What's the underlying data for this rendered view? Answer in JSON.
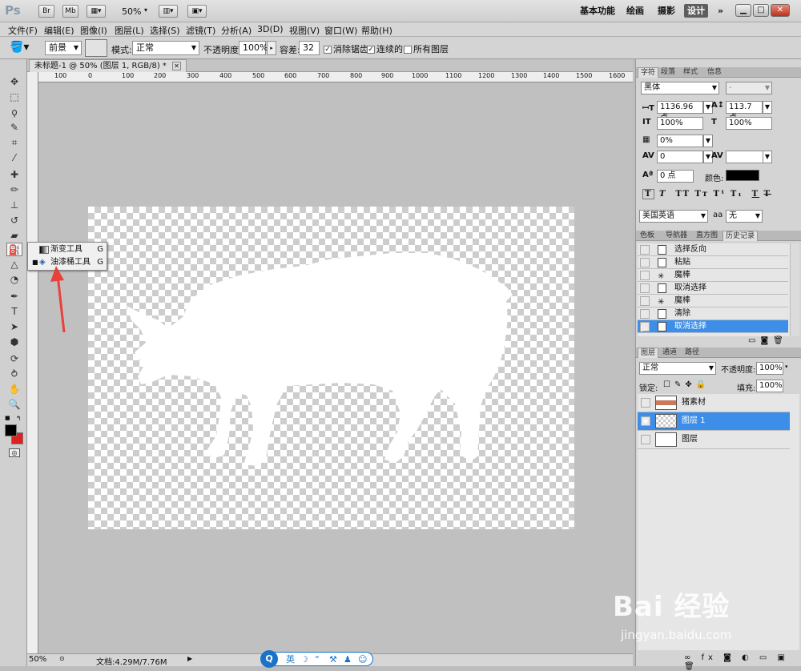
{
  "app": {
    "logo": "Ps",
    "chips": [
      "Br",
      "Mb"
    ],
    "zoom": "50%",
    "workspaces": [
      "基本功能",
      "绘画",
      "摄影",
      "设计"
    ],
    "active_workspace": "设计",
    "more": "»"
  },
  "menu": [
    "文件(F)",
    "编辑(E)",
    "图像(I)",
    "图层(L)",
    "选择(S)",
    "滤镜(T)",
    "分析(A)",
    "3D(D)",
    "视图(V)",
    "窗口(W)",
    "帮助(H)"
  ],
  "options": {
    "fill_source": "前景",
    "mode_label": "模式:",
    "mode": "正常",
    "opacity_label": "不透明度:",
    "opacity": "100%",
    "tolerance_label": "容差:",
    "tolerance": "32",
    "antialias": "消除锯齿",
    "contiguous": "连续的",
    "all_layers": "所有图层"
  },
  "document": {
    "tab": "未标题-1 @ 50% (图层 1, RGB/8) *",
    "ruler_h": [
      "100",
      "0",
      "100",
      "200",
      "300",
      "400",
      "500",
      "600",
      "700",
      "800",
      "900",
      "1000",
      "1100",
      "1200",
      "1300",
      "1400",
      "1500",
      "1600"
    ]
  },
  "flyout": {
    "items": [
      {
        "label": "渐变工具",
        "key": "G"
      },
      {
        "label": "油漆桶工具",
        "key": "G"
      }
    ]
  },
  "status": {
    "zoom": "50%",
    "doc": "文档:4.29M/7.76M"
  },
  "char_panel": {
    "tabs": [
      "字符",
      "段落",
      "样式",
      "信息"
    ],
    "font": "黑体",
    "style": "-",
    "size": "1136.96 点",
    "leading": "113.7 点",
    "vscale": "100%",
    "hscale": "100%",
    "tsume": "0%",
    "kerning": "0",
    "tracking": "",
    "baseline": "0 点",
    "color_label": "颜色:",
    "language": "美国英语",
    "aa_label": "aa",
    "aa": "无"
  },
  "history_panel": {
    "tabs": [
      "色板",
      "导航器",
      "直方图",
      "历史记录"
    ],
    "items": [
      "选择反向",
      "粘贴",
      "魔棒",
      "取消选择",
      "魔棒",
      "清除",
      "取消选择"
    ],
    "selected": 6
  },
  "layers_panel": {
    "tabs": [
      "图层",
      "通道",
      "路径"
    ],
    "blend": "正常",
    "opacity_label": "不透明度:",
    "opacity": "100%",
    "lock_label": "锁定:",
    "fill_label": "填充:",
    "fill": "100%",
    "layers": [
      "猪素材",
      "图层 1",
      "图层"
    ],
    "selected": 1
  },
  "watermark": {
    "logo": "Bai 经验",
    "url": "jingyan.baidu.com"
  },
  "ime": {
    "label": "英"
  },
  "colors": {
    "selection": "#3d8ee8",
    "arrow": "#e8403a",
    "fg": "#000000",
    "bg": "#e02020"
  }
}
